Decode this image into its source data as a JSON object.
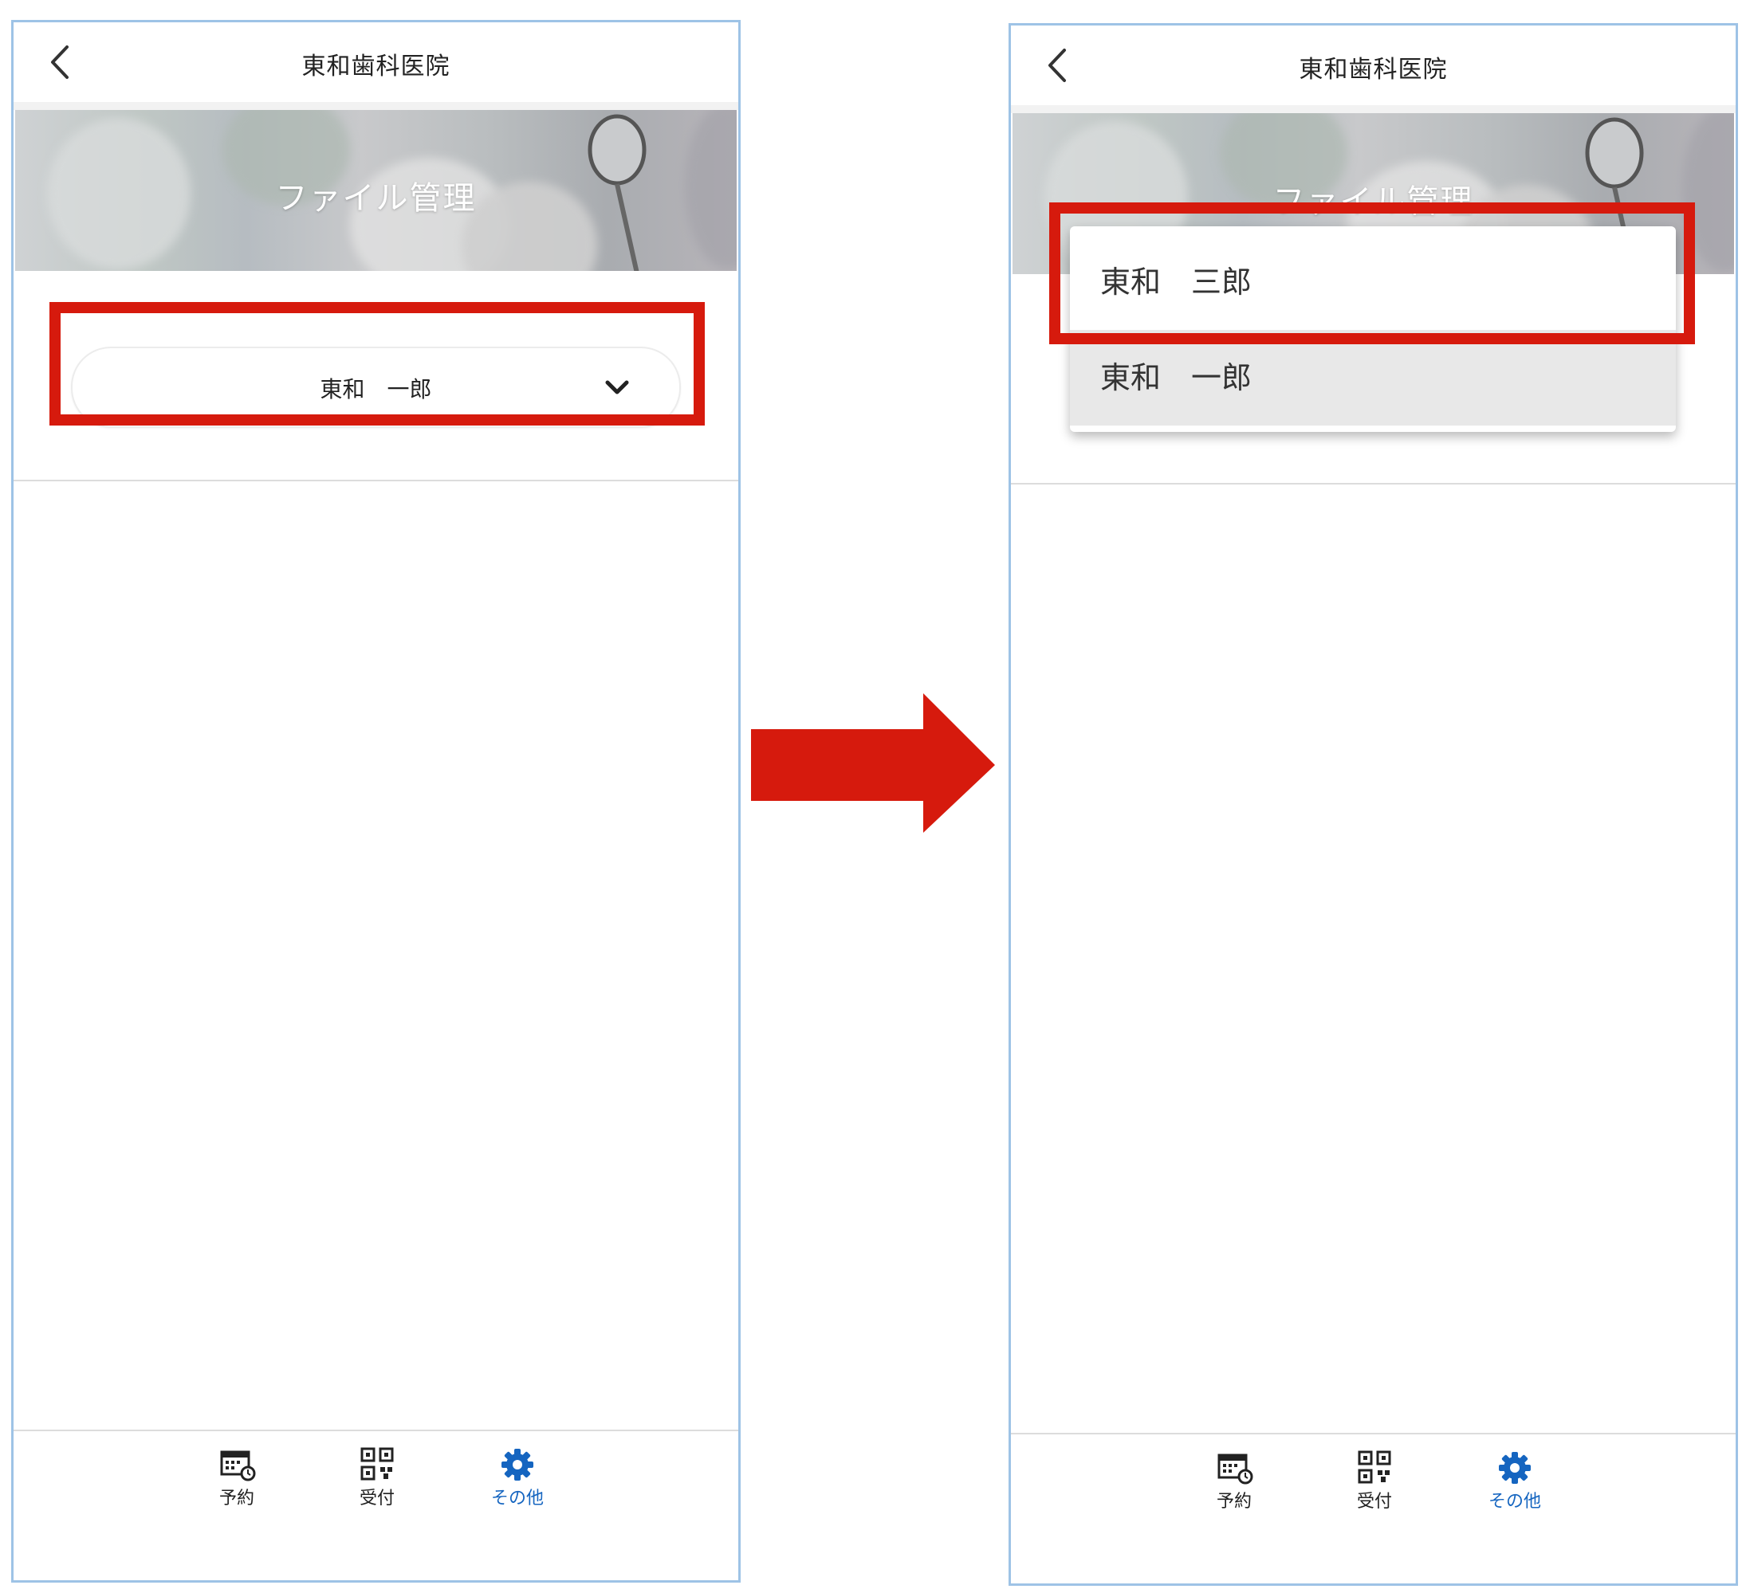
{
  "colors": {
    "highlight": "#d61a0d",
    "arrow": "#d61a0d",
    "active_tab": "#1565c0",
    "frame_border": "#9ec3e6"
  },
  "screens": {
    "left": {
      "header": {
        "back_icon": "chevron-left-icon",
        "title": "東和歯科医院"
      },
      "banner": {
        "title": "ファイル管理"
      },
      "patient_select": {
        "value": "東和　一郎",
        "icon": "chevron-down-icon"
      },
      "nav": [
        {
          "label": "予約",
          "icon": "calendar-clock-icon",
          "active": false
        },
        {
          "label": "受付",
          "icon": "qr-code-icon",
          "active": false
        },
        {
          "label": "その他",
          "icon": "gear-icon",
          "active": true
        }
      ]
    },
    "right": {
      "header": {
        "back_icon": "chevron-left-icon",
        "title": "東和歯科医院"
      },
      "banner": {
        "title": "ファイル管理"
      },
      "dropdown": {
        "options": [
          {
            "label": "東和　三郎",
            "selected": false
          },
          {
            "label": "東和　一郎",
            "selected": true
          }
        ]
      },
      "nav": [
        {
          "label": "予約",
          "icon": "calendar-clock-icon",
          "active": false
        },
        {
          "label": "受付",
          "icon": "qr-code-icon",
          "active": false
        },
        {
          "label": "その他",
          "icon": "gear-icon",
          "active": true
        }
      ]
    }
  },
  "transition_arrow": {
    "icon": "arrow-right-icon"
  }
}
